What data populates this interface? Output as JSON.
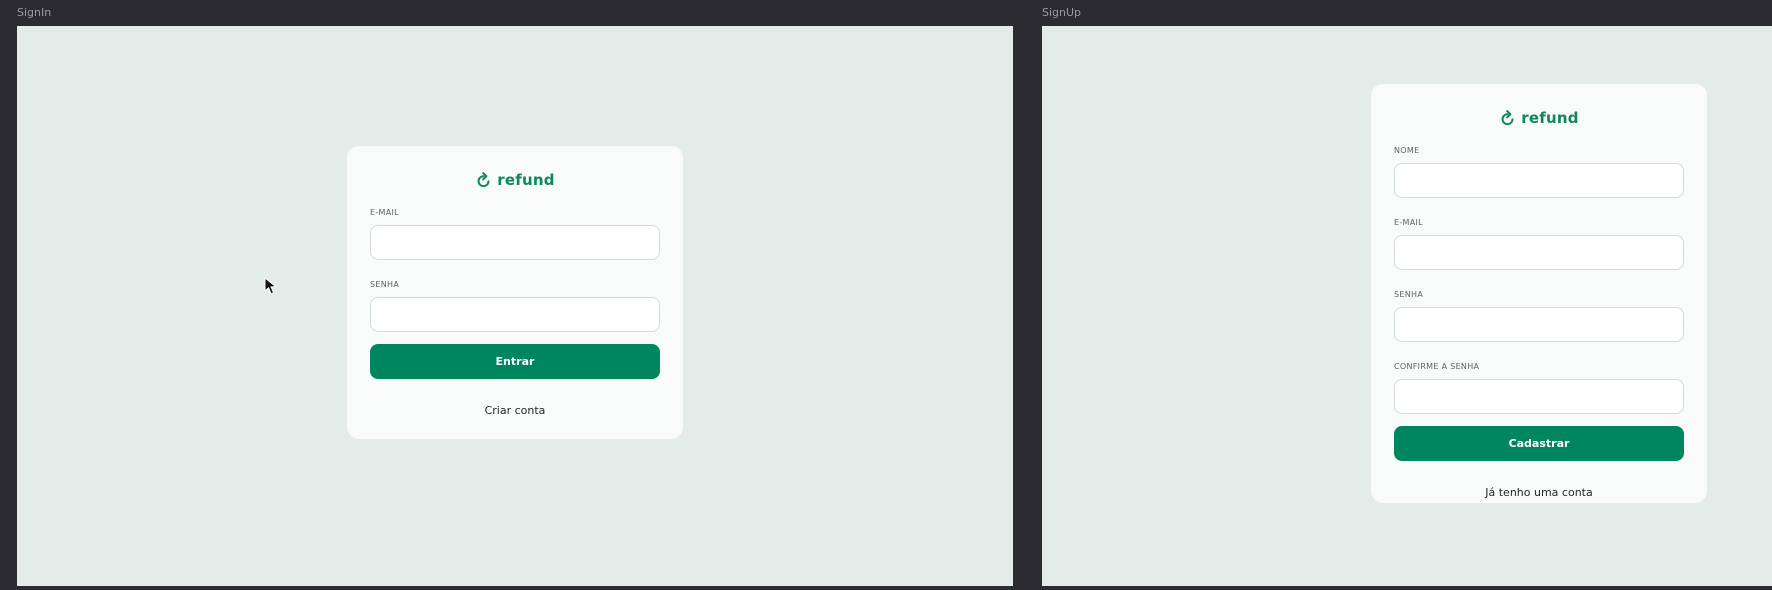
{
  "frames": {
    "signin": {
      "title": "SignIn",
      "logo_text": "refund",
      "email_label": "E-MAIL",
      "email_value": "",
      "password_label": "SENHA",
      "password_value": "",
      "submit_label": "Entrar",
      "link_label": "Criar conta"
    },
    "signup": {
      "title": "SignUp",
      "logo_text": "refund",
      "name_label": "NOME",
      "name_value": "",
      "email_label": "E-MAIL",
      "email_value": "",
      "password_label": "SENHA",
      "password_value": "",
      "confirm_label": "CONFIRME A SENHA",
      "confirm_value": "",
      "submit_label": "Cadastrar",
      "link_label": "Já tenho uma conta"
    }
  },
  "icons": {
    "logo": "refresh-arrow-icon",
    "cursor": "mouse-pointer-icon"
  },
  "colors": {
    "canvas_background": "#2c2c30",
    "frame_background": "#e4ecea",
    "card_background": "#f9fbfa",
    "brand_green": "#00865f",
    "logo_green": "#0e8760"
  }
}
